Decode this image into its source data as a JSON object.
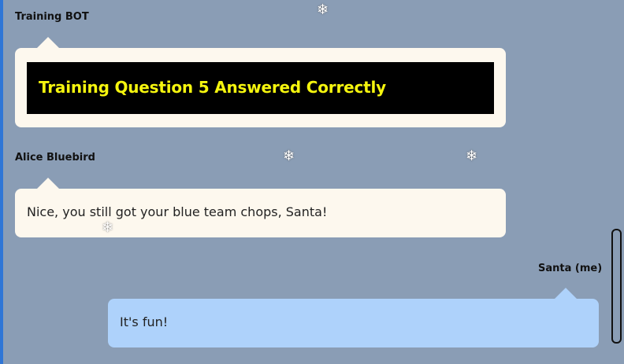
{
  "messages": [
    {
      "sender": "Training BOT",
      "banner_text": "Training Question 5 Answered Correctly"
    },
    {
      "sender": "Alice Bluebird",
      "text": "Nice, you still got your blue team chops, Santa!"
    },
    {
      "sender": "Santa (me)",
      "text": "It's fun!"
    }
  ],
  "decorations": {
    "snowflake_glyph": "❄",
    "colors": {
      "background": "#8a9db5",
      "incoming_bubble": "#fdf8ee",
      "outgoing_bubble": "#aed2fb",
      "banner_background": "#000000",
      "banner_text": "#f5f50e",
      "left_accent": "#2f76d6"
    }
  }
}
